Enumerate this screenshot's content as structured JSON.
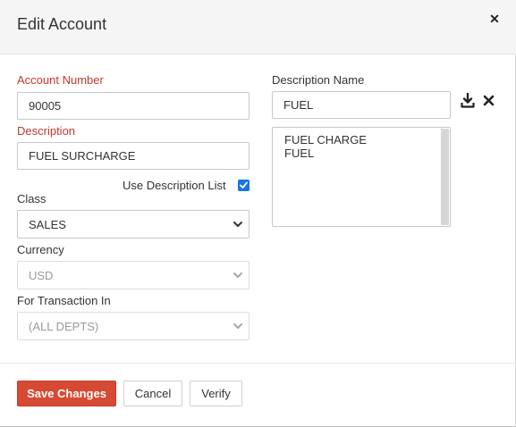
{
  "dialog": {
    "title": "Edit Account",
    "close_icon": "close-icon"
  },
  "form": {
    "account_number": {
      "label": "Account Number",
      "value": "90005"
    },
    "description": {
      "label": "Description",
      "value": "FUEL SURCHARGE"
    },
    "use_description_list": {
      "label": "Use Description List",
      "checked": true
    },
    "class": {
      "label": "Class",
      "value": "SALES"
    },
    "currency": {
      "label": "Currency",
      "value": "USD",
      "disabled": true
    },
    "for_transaction_in": {
      "label": "For Transaction In",
      "value": "(ALL DEPTS)",
      "disabled": true
    },
    "description_name": {
      "label": "Description Name",
      "value": "FUEL"
    },
    "description_list": [
      "FUEL CHARGE",
      "FUEL"
    ]
  },
  "icons": {
    "download": "download-icon",
    "remove": "close-icon"
  },
  "footer": {
    "save_label": "Save Changes",
    "cancel_label": "Cancel",
    "verify_label": "Verify"
  },
  "colors": {
    "required_label": "#c0392b",
    "primary_button": "#d64a33",
    "checkbox": "#1a73e8",
    "header_bg": "#f5f5f5"
  }
}
